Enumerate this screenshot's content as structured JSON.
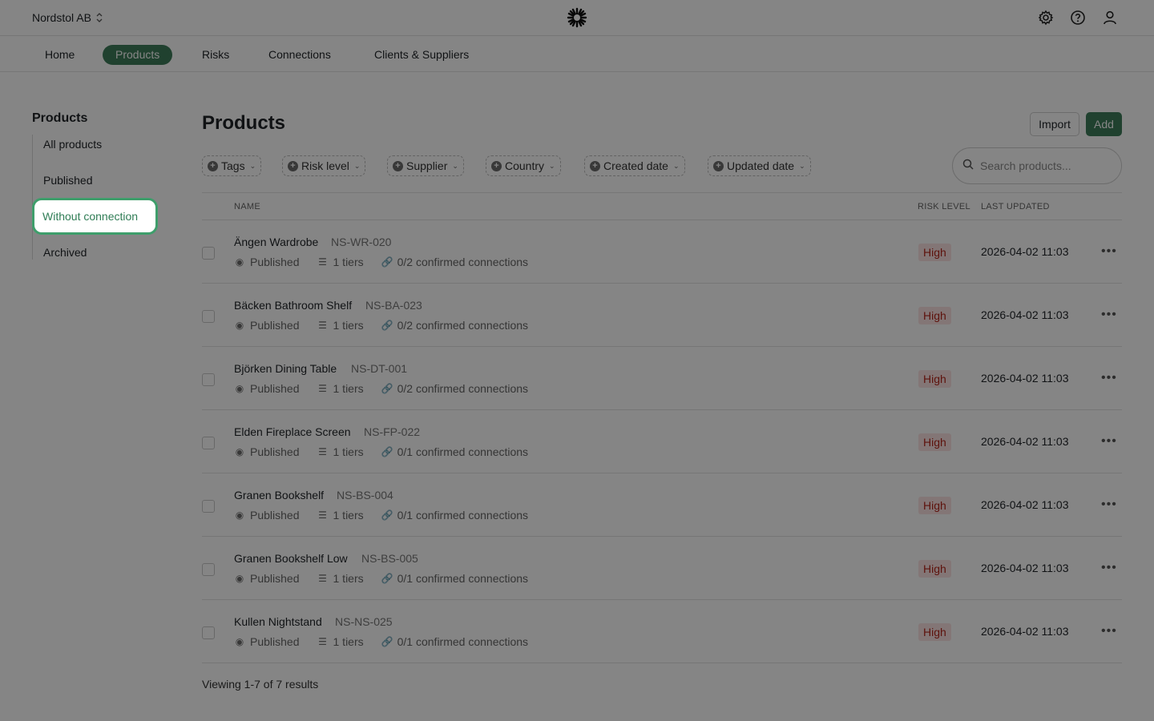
{
  "header": {
    "org_name": "Nordstol AB",
    "org_selector_icon": "chevron-up-down-icon",
    "logo_icon": "snowflake-logo-icon",
    "icons": [
      "gear-icon",
      "help-icon",
      "user-icon"
    ]
  },
  "nav": {
    "tabs": [
      {
        "label": "Home"
      },
      {
        "label": "Products"
      },
      {
        "label": "Risks"
      },
      {
        "label": "Connections"
      },
      {
        "label": "Clients & Suppliers"
      }
    ],
    "active": "Products"
  },
  "sidebar": {
    "title": "Products",
    "items": [
      {
        "label": "All products"
      },
      {
        "label": "Published"
      },
      {
        "label": "Without connection"
      },
      {
        "label": "Archived"
      }
    ],
    "highlighted": "Without connection"
  },
  "main": {
    "title": "Products",
    "import_label": "Import",
    "add_label": "Add",
    "filters": [
      {
        "label": "Tags"
      },
      {
        "label": "Risk level"
      },
      {
        "label": "Supplier"
      },
      {
        "label": "Country"
      },
      {
        "label": "Created date"
      },
      {
        "label": "Updated date"
      }
    ],
    "search": {
      "placeholder": "Search products...",
      "value": ""
    },
    "columns": {
      "name": "NAME",
      "risk": "RISK LEVEL",
      "updated": "LAST UPDATED"
    },
    "rows": [
      {
        "name": "Ängen Wardrobe",
        "code": "NS-WR-020",
        "status": "Published",
        "tiers": "1 tiers",
        "connections": "0/2 confirmed connections",
        "risk": "High",
        "updated": "2026-04-02 11:03"
      },
      {
        "name": "Bäcken Bathroom Shelf",
        "code": "NS-BA-023",
        "status": "Published",
        "tiers": "1 tiers",
        "connections": "0/2 confirmed connections",
        "risk": "High",
        "updated": "2026-04-02 11:03"
      },
      {
        "name": "Björken Dining Table",
        "code": "NS-DT-001",
        "status": "Published",
        "tiers": "1 tiers",
        "connections": "0/2 confirmed connections",
        "risk": "High",
        "updated": "2026-04-02 11:03"
      },
      {
        "name": "Elden Fireplace Screen",
        "code": "NS-FP-022",
        "status": "Published",
        "tiers": "1 tiers",
        "connections": "0/1 confirmed connections",
        "risk": "High",
        "updated": "2026-04-02 11:03"
      },
      {
        "name": "Granen Bookshelf",
        "code": "NS-BS-004",
        "status": "Published",
        "tiers": "1 tiers",
        "connections": "0/1 confirmed connections",
        "risk": "High",
        "updated": "2026-04-02 11:03"
      },
      {
        "name": "Granen Bookshelf Low",
        "code": "NS-BS-005",
        "status": "Published",
        "tiers": "1 tiers",
        "connections": "0/1 confirmed connections",
        "risk": "High",
        "updated": "2026-04-02 11:03"
      },
      {
        "name": "Kullen Nightstand",
        "code": "NS-NS-025",
        "status": "Published",
        "tiers": "1 tiers",
        "connections": "0/1 confirmed connections",
        "risk": "High",
        "updated": "2026-04-02 11:03"
      }
    ],
    "footer": "Viewing 1-7 of 7 results"
  },
  "colors": {
    "accent": "#3e7d5b",
    "risk_high_bg": "#fbe3e3",
    "risk_high_text": "#b42318"
  }
}
